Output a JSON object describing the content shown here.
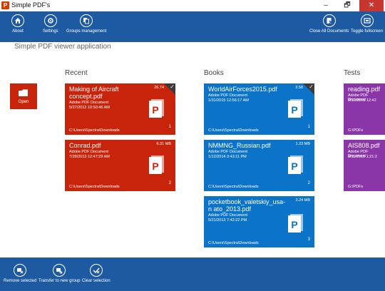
{
  "window": {
    "title": "Simple PDF's",
    "app_icon_letter": "P",
    "minimize": "–",
    "maximize": "🗗",
    "close": "✕"
  },
  "appbar": {
    "about": "About",
    "settings": "Settings",
    "groups": "Groups management",
    "close_all": "Close All Documents",
    "toggle_fullscreen": "Toggle fullscreen"
  },
  "subtitle": "Simple PDF viewer application",
  "open_label": "Open",
  "groups": [
    {
      "title": "Recent",
      "color": "#c8240b",
      "tiles": [
        {
          "name": "Making of Aircraft concept.pdf",
          "type": "Adobe PDF Document",
          "date": "5/27/2012 10:50:46 AM",
          "size": "26.74",
          "path": "C:\\Users\\Spectra\\Downloads",
          "pages": "1"
        },
        {
          "name": "Conrad.pdf",
          "type": "Adobe PDF Document",
          "date": "7/28/2013 12:47:29 AM",
          "size": "6.31 MB",
          "path": "C:\\Users\\Spectra\\Downloads",
          "pages": "2"
        }
      ]
    },
    {
      "title": "Books",
      "color": "#0b73c8",
      "tiles": [
        {
          "name": "WorldAirForces2015.pdf",
          "type": "Adobe PDF Document",
          "date": "1/31/2015 12:56:17 AM",
          "size": "3.58",
          "path": "C:\\Users\\Spectra\\Downloads",
          "pages": "1"
        },
        {
          "name": "NMMNG_Russian.pdf",
          "type": "Adobe PDF Document",
          "date": "1/12/2014 3:43:11 PM",
          "size": "1.23 MB",
          "path": "C:\\Users\\Spectra\\Downloads",
          "pages": "2"
        },
        {
          "name": "pocketbook_valetskiy_usa-n ato_2013.pdf",
          "type": "Adobe PDF Document",
          "date": "5/21/2013 7:42:22 PM",
          "size": "3.24 MB",
          "path": "C:\\Users\\Spectra\\Downloads",
          "pages": "3"
        }
      ]
    },
    {
      "title": "Tests",
      "color": "#8b36a8",
      "tiles": [
        {
          "name": "reading.pdf",
          "type": "Adobe PDF Document",
          "date": "8/12/2015 12:42",
          "path": "G:\\PDFs"
        },
        {
          "name": "AIS808.pdf",
          "type": "Adobe PDF Document",
          "date": "8/11/2015 1:21:2",
          "path": "G:\\PDFs"
        }
      ]
    }
  ],
  "bottombar": {
    "remove": "Remove selected",
    "transfer": "Transfer to new group",
    "clear": "Clear selection"
  },
  "colors": {
    "bar": "#1d5aa1",
    "red": "#c8240b",
    "blue": "#0b73c8",
    "purple": "#8b36a8"
  }
}
